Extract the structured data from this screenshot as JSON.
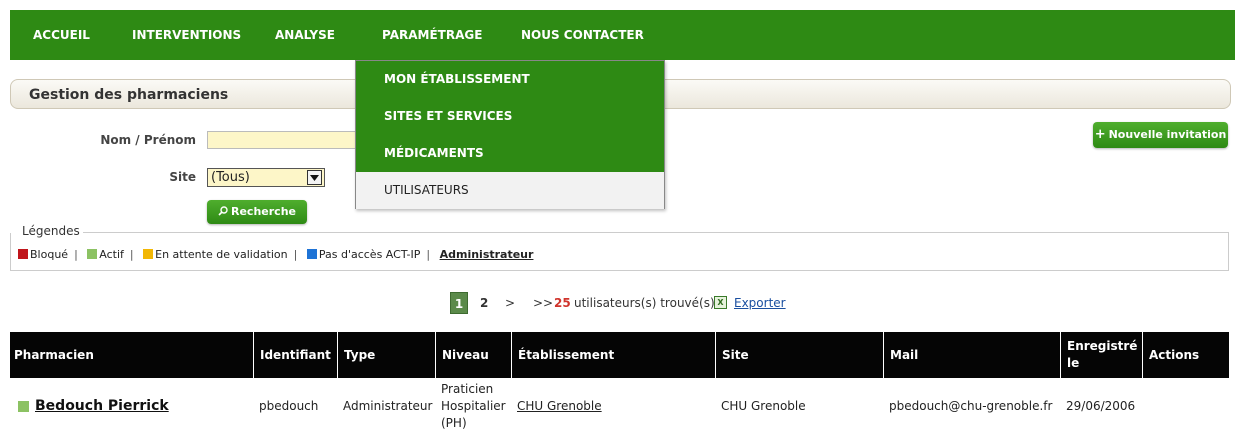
{
  "nav": {
    "items": [
      "ACCUEIL",
      "INTERVENTIONS",
      "ANALYSE",
      "PARAMÉTRAGE",
      "NOUS CONTACTER"
    ],
    "bg_color": "#2e8a14"
  },
  "dropdown": {
    "items": [
      "MON ÉTABLISSEMENT",
      "SITES ET SERVICES",
      "MÉDICAMENTS",
      "UTILISATEURS"
    ]
  },
  "panel": {
    "title": "Gestion des pharmaciens"
  },
  "form": {
    "name_label": "Nom / Prénom",
    "name_value": "",
    "site_label": "Site",
    "site_value": "(Tous)",
    "search_button": "Recherche",
    "new_invite_button": "Nouvelle invitation"
  },
  "legend": {
    "title": "Légendes",
    "items": [
      {
        "label": "Bloqué",
        "color": "#c0151b"
      },
      {
        "label": "Actif",
        "color": "#8cc263"
      },
      {
        "label": "En attente de validation",
        "color": "#f2b705"
      },
      {
        "label": "Pas d'accès ACT-IP",
        "color": "#1e73d6"
      }
    ],
    "admin_label": "Administrateur"
  },
  "pager": {
    "current_page": "1",
    "next_page": "2",
    "next": ">",
    "last": ">>",
    "count": "25",
    "count_suffix": "utilisateurs(s) trouvé(s)",
    "export_label": "Exporter"
  },
  "table": {
    "headers": [
      "Pharmacien",
      "Identifiant",
      "Type",
      "Niveau",
      "Établissement",
      "Site",
      "Mail",
      "Enregistré le",
      "Actions"
    ],
    "rows": [
      {
        "status_color": "#8cc263",
        "name": "Bedouch Pierrick",
        "identifiant": "pbedouch",
        "type": "Administrateur",
        "niveau": "Praticien Hospitalier (PH)",
        "etablissement": "CHU Grenoble",
        "site": "CHU Grenoble",
        "mail": "pbedouch@chu-grenoble.fr",
        "enregistre": "29/06/2006",
        "actions": ""
      }
    ]
  }
}
